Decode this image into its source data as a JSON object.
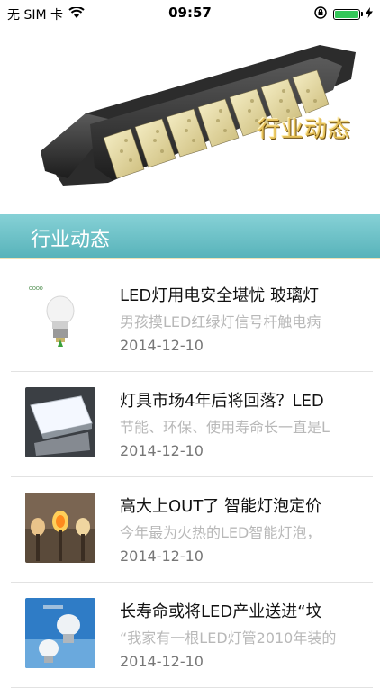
{
  "status_bar": {
    "carrier": "无 SIM 卡",
    "time": "09:57"
  },
  "banner": {
    "overlay_text": "行业动态"
  },
  "section": {
    "title": "行业动态"
  },
  "news": [
    {
      "title": "LED灯用电安全堪忧 玻璃灯",
      "summary": "男孩摸LED红绿灯信号杆触电病",
      "date": "2014-12-10"
    },
    {
      "title": "灯具市场4年后将回落？LED",
      "summary": "节能、环保、使用寿命长一直是L",
      "date": "2014-12-10"
    },
    {
      "title": "高大上OUT了 智能灯泡定价",
      "summary": "今年最为火热的LED智能灯泡，",
      "date": "2014-12-10"
    },
    {
      "title": "长寿命或将LED产业送进“坟",
      "summary": "“我家有一根LED灯管2010年装的",
      "date": "2014-12-10"
    }
  ]
}
